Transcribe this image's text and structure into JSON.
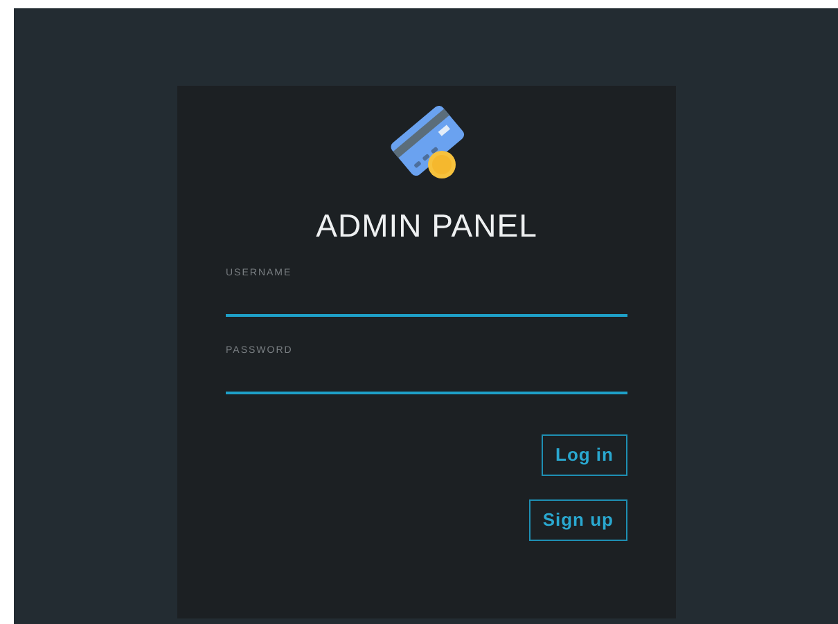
{
  "title": "ADMIN PANEL",
  "fields": [
    {
      "label": "USERNAME"
    },
    {
      "label": "PASSWORD"
    }
  ],
  "buttons": [
    "Log in",
    "Sign up"
  ]
}
